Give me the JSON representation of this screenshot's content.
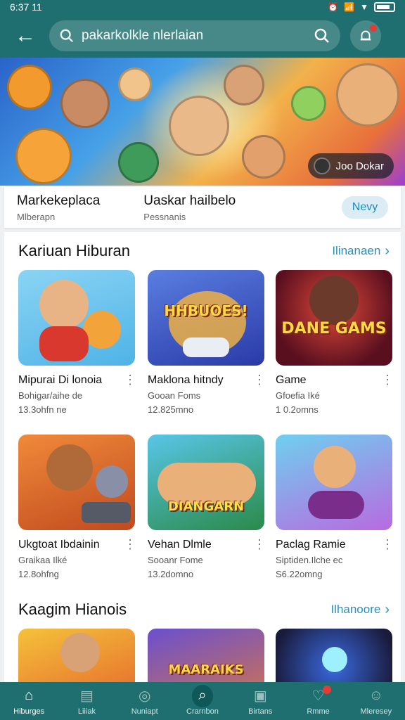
{
  "status": {
    "time": "6:37 11"
  },
  "search": {
    "placeholder": "pakarkolkle nlerlaian"
  },
  "banner": {
    "chip": "Joo Dokar"
  },
  "marketplace": {
    "title": "Markekeplaca",
    "subtitle": "Mlberapn",
    "col2_title": "Uaskar hailbelo",
    "col2_subtitle": "Pessnanis",
    "button": "Nevy"
  },
  "sections": [
    {
      "title": "Kariuan Hiburan",
      "link": "Ilinanaen",
      "cards": [
        {
          "title": "Mipurai Di lonoia",
          "sub": "Bohigar/aihe de",
          "meta": "13.3ohfn ne",
          "logo": ""
        },
        {
          "title": "Maklona hitndy",
          "sub": "Gooan Foms",
          "meta": "12.825mno",
          "logo": "HHBUOES!"
        },
        {
          "title": "Game",
          "sub": "Gfoefia Iké",
          "meta": "1 0.2omns",
          "logo": "DANE GAMS"
        },
        {
          "title": "Ukgtoat Ibdainin",
          "sub": "Graikaa Ilké",
          "meta": "12.8ohfng",
          "logo": ""
        },
        {
          "title": "Vehan Dlmle",
          "sub": "Sooanr Fome",
          "meta": "13.2domno",
          "logo": "DIANGARN"
        },
        {
          "title": "Paclag Ramie",
          "sub": "Siptiden.Ilche ec",
          "meta": "S6.22omng",
          "logo": ""
        }
      ]
    },
    {
      "title": "Kaagim Hianois",
      "link": "Ilhanoore",
      "cards": [
        {
          "logo": ""
        },
        {
          "logo": "MAARAIKS"
        },
        {
          "logo": ""
        }
      ]
    }
  ],
  "nav": [
    {
      "label": "Hiburges",
      "icon": "home-icon"
    },
    {
      "label": "Liiiak",
      "icon": "list-icon"
    },
    {
      "label": "Nuniapt",
      "icon": "radio-icon"
    },
    {
      "label": "Crarnbon",
      "icon": "search-icon"
    },
    {
      "label": "Birtans",
      "icon": "bag-icon"
    },
    {
      "label": "Rmme",
      "icon": "chat-icon"
    },
    {
      "label": "Mleresey",
      "icon": "profile-icon"
    }
  ],
  "colors": {
    "primary": "#1f6f70",
    "accent": "#2a8fc4",
    "badge": "#e53935"
  }
}
